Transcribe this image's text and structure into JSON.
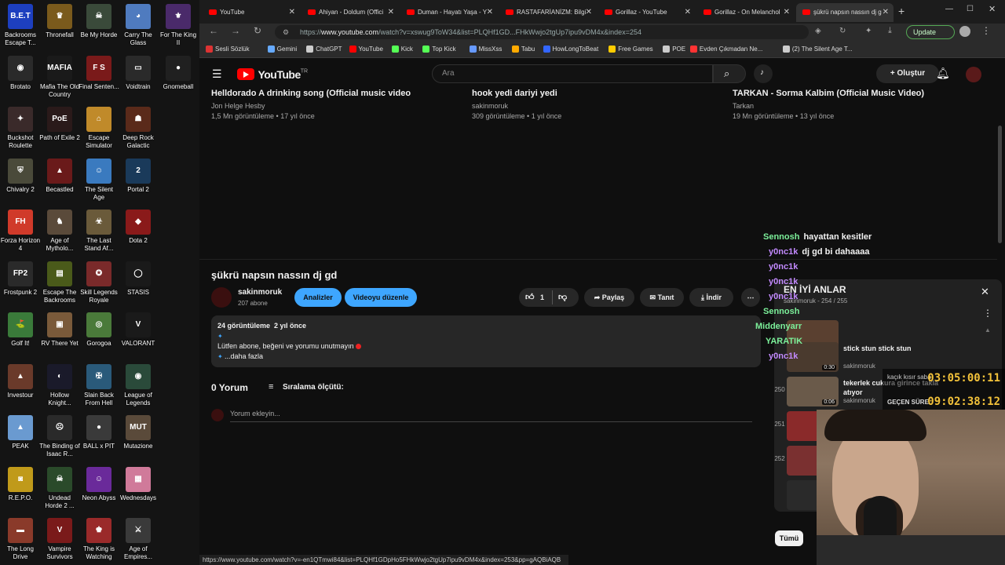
{
  "desktop": {
    "icons": [
      {
        "label": "Backrooms Escape T...",
        "bg": "#1d3fbf",
        "glyph": "B.E.T"
      },
      {
        "label": "Thronefall",
        "bg": "#7a5a1c",
        "glyph": "♛"
      },
      {
        "label": "Be My Horde",
        "bg": "#3a4a3a",
        "glyph": "☠"
      },
      {
        "label": "Carry The Glass",
        "bg": "#4f7bbf",
        "glyph": "◕"
      },
      {
        "label": "For The King II",
        "bg": "#4a2a6a",
        "glyph": "⚜"
      },
      {
        "label": "Brotato",
        "bg": "#2a2a2a",
        "glyph": "◉"
      },
      {
        "label": "Mafia The Old Country",
        "bg": "#1a1a1a",
        "glyph": "MAFIA"
      },
      {
        "label": "Final Senten...",
        "bg": "#7a1a1a",
        "glyph": "F S"
      },
      {
        "label": "Voidtrain",
        "bg": "#2a2a2a",
        "glyph": "▭"
      },
      {
        "label": "Gnomeball",
        "bg": "#202020",
        "glyph": "●"
      },
      {
        "label": "Buckshot Roulette",
        "bg": "#3a2a2a",
        "glyph": "✦"
      },
      {
        "label": "Path of Exile 2",
        "bg": "#2a1a1a",
        "glyph": "PoE"
      },
      {
        "label": "Escape Simulator",
        "bg": "#c08a2a",
        "glyph": "⌂"
      },
      {
        "label": "Deep Rock Galactic",
        "bg": "#5a2a1a",
        "glyph": "☗"
      },
      {
        "label": "Chivalry 2",
        "bg": "#4a4a3a",
        "glyph": "⛨"
      },
      {
        "label": "Becastled",
        "bg": "#6a1a1a",
        "glyph": "▲"
      },
      {
        "label": "The Silent Age",
        "bg": "#3a7abf",
        "glyph": "☺"
      },
      {
        "label": "Portal 2",
        "bg": "#1a3a5a",
        "glyph": "2"
      },
      {
        "label": "Forza Horizon 4",
        "bg": "#d03a2a",
        "glyph": "FH"
      },
      {
        "label": "Age of Mytholo...",
        "bg": "#5a4a3a",
        "glyph": "♞"
      },
      {
        "label": "The Last Stand Af...",
        "bg": "#6a5a3a",
        "glyph": "☣"
      },
      {
        "label": "Dota 2",
        "bg": "#8a1a1a",
        "glyph": "◆"
      },
      {
        "label": "Frostpunk 2",
        "bg": "#2a2a2a",
        "glyph": "FP2"
      },
      {
        "label": "Escape The Backrooms",
        "bg": "#4a5a1a",
        "glyph": "▤"
      },
      {
        "label": "Skill Legends Royale",
        "bg": "#7a2a2a",
        "glyph": "✪"
      },
      {
        "label": "STASIS",
        "bg": "#1a1a1a",
        "glyph": "◯"
      },
      {
        "label": "Golf It!",
        "bg": "#3a7a3a",
        "glyph": "⛳"
      },
      {
        "label": "RV There Yet",
        "bg": "#7a5a3a",
        "glyph": "▣"
      },
      {
        "label": "Gorogoa",
        "bg": "#4a7a3a",
        "glyph": "◎"
      },
      {
        "label": "VALORANT",
        "bg": "#1a1a1a",
        "glyph": "V"
      },
      {
        "label": "Investour",
        "bg": "#6a3a2a",
        "glyph": "▲"
      },
      {
        "label": "Hollow Knight...",
        "bg": "#1a1a2a",
        "glyph": "◐"
      },
      {
        "label": "Slain Back From Hell",
        "bg": "#2a5a7a",
        "glyph": "✠"
      },
      {
        "label": "League of Legends",
        "bg": "#2a4a3a",
        "glyph": "◉"
      },
      {
        "label": "PEAK",
        "bg": "#6a9ad0",
        "glyph": "▲"
      },
      {
        "label": "The Binding of Isaac R...",
        "bg": "#2a2a2a",
        "glyph": "☹"
      },
      {
        "label": "BALL x PIT",
        "bg": "#3a3a3a",
        "glyph": "●"
      },
      {
        "label": "Mutazione",
        "bg": "#5a4a3a",
        "glyph": "MUT"
      },
      {
        "label": "R.E.P.O.",
        "bg": "#c09a1a",
        "glyph": "◙"
      },
      {
        "label": "Undead Horde 2 ...",
        "bg": "#2a4a2a",
        "glyph": "☠"
      },
      {
        "label": "Neon Abyss",
        "bg": "#6a2a9a",
        "glyph": "☺"
      },
      {
        "label": "Wednesdays",
        "bg": "#d07a9a",
        "glyph": "▦"
      },
      {
        "label": "The Long Drive",
        "bg": "#8a3a2a",
        "glyph": "▬"
      },
      {
        "label": "Vampire Survivors",
        "bg": "#7a1a1a",
        "glyph": "V"
      },
      {
        "label": "The King is Watching",
        "bg": "#9a2a2a",
        "glyph": "♚"
      },
      {
        "label": "Age of Empires...",
        "bg": "#3a3a3a",
        "glyph": "⚔"
      }
    ]
  },
  "tabs": [
    {
      "label": "YouTube"
    },
    {
      "label": "Ahiyan - Doldum (Offici"
    },
    {
      "label": "Duman - Hayatı Yaşa - Y"
    },
    {
      "label": "RASTAFARİANİZM: Bilgi"
    },
    {
      "label": "Gorillaz - YouTube"
    },
    {
      "label": "Gorillaz - On Melanchol"
    },
    {
      "label": "şükrü napsın nassın dj g"
    }
  ],
  "address": {
    "url_prefix": "https://",
    "url_host": "www.youtube.com",
    "url_rest": "/watch?v=xswug9ToW34&list=PLQHf1GD...FHkWwjo2tgUp7ipu9vDM4x&index=254",
    "update_label": "Update"
  },
  "bookmarks": [
    {
      "label": "Sesli Sözlük",
      "color": "#d33"
    },
    {
      "label": "Gemini",
      "color": "#6af"
    },
    {
      "label": "ChatGPT",
      "color": "#ccc"
    },
    {
      "label": "YouTube",
      "color": "#f00"
    },
    {
      "label": "Kick",
      "color": "#5f5"
    },
    {
      "label": "Top Kick",
      "color": "#5f5"
    },
    {
      "label": "MissXss",
      "color": "#69f"
    },
    {
      "label": "Tabu",
      "color": "#fa0"
    },
    {
      "label": "HowLongToBeat",
      "color": "#36f"
    },
    {
      "label": "Free Games",
      "color": "#fc0"
    },
    {
      "label": "POE",
      "color": "#ccc"
    },
    {
      "label": "Evden Çıkmadan Ne...",
      "color": "#f33"
    },
    {
      "label": "(2) The Silent Age T...",
      "color": "#ccc"
    }
  ],
  "yt": {
    "logo": "YouTube",
    "logo_sup": "TR",
    "search_placeholder": "Ara",
    "create_label": "Oluştur"
  },
  "related": [
    {
      "title": "Helldorado A drinking song (Official music video",
      "channel": "Jon Helge Hesby",
      "meta": "1,5 Mn görüntüleme • 17 yıl önce"
    },
    {
      "title": "hook yedi dariyi yedi",
      "channel": "sakinmoruk",
      "meta": "309 görüntüleme • 1 yıl önce"
    },
    {
      "title": "TARKAN - Sorma Kalbim (Official Music Video)",
      "channel": "Tarkan",
      "meta": "19 Mn görüntüleme • 13 yıl önce"
    }
  ],
  "video": {
    "title": "şükrü napsın nassın dj gd",
    "channel": "sakinmoruk",
    "subs": "207 abone",
    "analyze_label": "Analizler",
    "edit_label": "Videoyu düzenle",
    "likes": "1",
    "share_label": "Paylaş",
    "promote_label": "Tanıt",
    "download_label": "İndir",
    "views": "24 görüntüleme",
    "age": "2 yıl önce",
    "desc_line": "Lütfen abone, beğeni ve yorumu unutmayın",
    "more_label": "...daha fazla",
    "comments_count": "0 Yorum",
    "sort_label": "Sıralama ölçütü:",
    "comment_placeholder": "Yorum ekleyin..."
  },
  "chat": [
    {
      "user": "Sennosh",
      "msg": "hayattan kesitler",
      "style": "green"
    },
    {
      "user": "y0nc1k",
      "msg": "dj gd bi dahaaaa",
      "style": "purple"
    },
    {
      "user": "y0nc1k",
      "msg": "",
      "style": "purple"
    },
    {
      "user": "y0nc1k",
      "msg": "",
      "style": "purple"
    },
    {
      "user": "y0nc1k",
      "msg": "",
      "style": "purple"
    },
    {
      "user": "Sennosh",
      "msg": "",
      "style": "green"
    },
    {
      "user": "Middenyarr",
      "msg": "",
      "style": "green"
    },
    {
      "user": "YARATIK",
      "msg": "",
      "style": "green"
    },
    {
      "user": "y0nc1k",
      "msg": "",
      "style": "purple"
    }
  ],
  "playlist": {
    "title": "EN İYİ ANLAR",
    "owner": "sakinmoruk",
    "position": "254 / 255",
    "items": [
      {
        "num": "",
        "duration": "0:25",
        "title": "",
        "channel": ""
      },
      {
        "num": "",
        "duration": "0:30",
        "title": "stick stun stick stun",
        "channel": "sakinmoruk"
      },
      {
        "num": "250",
        "duration": "0:06",
        "title": "tekerlek cukura girince takla atıyor",
        "channel": "sakinmoruk"
      },
      {
        "num": "251",
        "duration": "",
        "title": "",
        "channel": ""
      },
      {
        "num": "252",
        "duration": "",
        "title": "",
        "channel": ""
      },
      {
        "num": "",
        "duration": "",
        "title": "",
        "channel": ""
      }
    ],
    "filter_label": "Tümü"
  },
  "overlay": {
    "timer_top": "03:05:00:11",
    "timer_bottom": "09:02:38:12",
    "timer_label": "GEÇEN SÜRE",
    "timer_top_label": "kaçık kısır saba"
  },
  "statusbar": "https://www.youtube.com/watch?v=-en1QTmwi84&list=PLQHf1GDpHo5FHkWwjo2tgUp7ipu9vDM4x&index=253&pp=gAQBiAQB"
}
